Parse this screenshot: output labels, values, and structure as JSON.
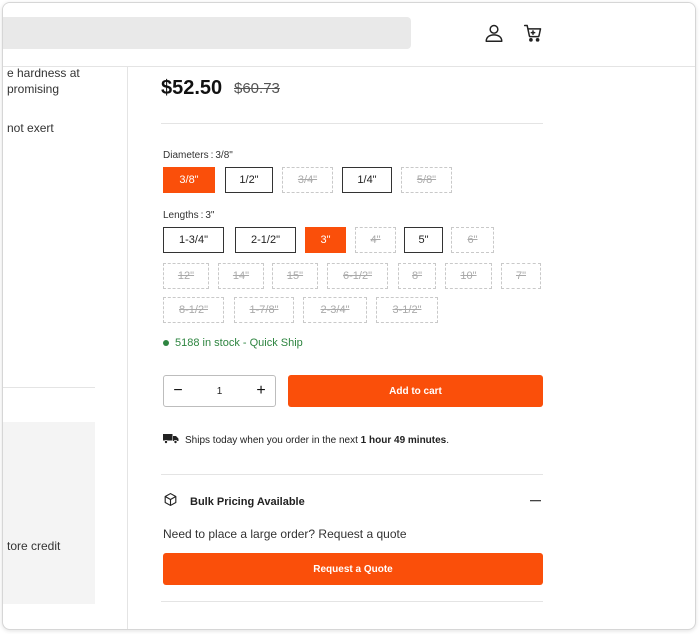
{
  "header": {
    "search_value": "",
    "icons": {
      "account": "account-icon",
      "cart": "cart-icon"
    }
  },
  "left_panel": {
    "line1": "e hardness at",
    "line2": "promising",
    "line3": "not exert",
    "credit": "tore credit"
  },
  "product": {
    "price": "$52.50",
    "old_price": "$60.73"
  },
  "diameters": {
    "label": "Diameters",
    "separator": ":",
    "selected": "3/8\"",
    "options": [
      {
        "label": "3/8\"",
        "state": "selected"
      },
      {
        "label": "1/2\"",
        "state": "available"
      },
      {
        "label": "3/4\"",
        "state": "unavailable"
      },
      {
        "label": "1/4\"",
        "state": "available"
      },
      {
        "label": "5/8\"",
        "state": "unavailable"
      }
    ]
  },
  "lengths": {
    "label": "Lengths",
    "separator": ":",
    "selected": "3\"",
    "options": [
      {
        "label": "1-3/4\"",
        "state": "available"
      },
      {
        "label": "2-1/2\"",
        "state": "available"
      },
      {
        "label": "3\"",
        "state": "selected"
      },
      {
        "label": "4\"",
        "state": "unavailable"
      },
      {
        "label": "5\"",
        "state": "available"
      },
      {
        "label": "6\"",
        "state": "unavailable"
      },
      {
        "label": "12\"",
        "state": "unavailable"
      },
      {
        "label": "14\"",
        "state": "unavailable"
      },
      {
        "label": "15\"",
        "state": "unavailable"
      },
      {
        "label": "6-1/2\"",
        "state": "unavailable"
      },
      {
        "label": "8\"",
        "state": "unavailable"
      },
      {
        "label": "10\"",
        "state": "unavailable"
      },
      {
        "label": "7\"",
        "state": "unavailable"
      },
      {
        "label": "8-1/2\"",
        "state": "unavailable"
      },
      {
        "label": "1-7/8\"",
        "state": "unavailable"
      },
      {
        "label": "2-3/4\"",
        "state": "unavailable"
      },
      {
        "label": "3-1/2\"",
        "state": "unavailable"
      }
    ]
  },
  "stock": {
    "text": "5188 in stock - Quick Ship",
    "color": "#2e8540"
  },
  "quantity": {
    "minus": "−",
    "value": "1",
    "plus": "+"
  },
  "add_to_cart_label": "Add to cart",
  "shipping": {
    "prefix": "Ships today when you order in the next",
    "countdown": "1 hour 49 minutes",
    "suffix": "."
  },
  "bulk": {
    "title": "Bulk Pricing Available",
    "text": "Need to place a large order? Request a quote",
    "button_label": "Request a Quote"
  },
  "colors": {
    "accent": "#fa4f0a",
    "border": "#e4e4e4"
  }
}
